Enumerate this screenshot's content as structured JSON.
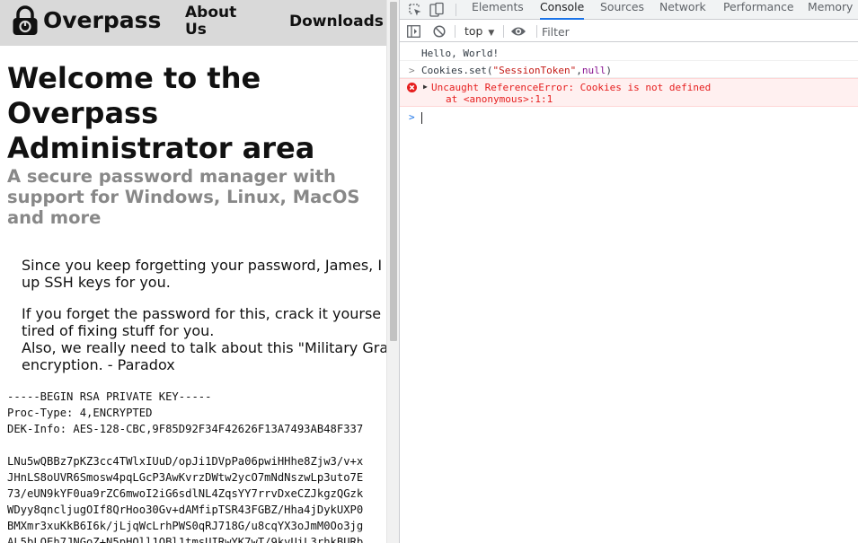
{
  "site": {
    "name": "Overpass",
    "nav": {
      "about": "About Us",
      "downloads": "Downloads"
    }
  },
  "content": {
    "title": "Welcome to the Overpass Administrator area",
    "subtitle": "A secure password manager with support for Windows, Linux, MacOS and more",
    "message1": "Since you keep forgetting your password, James, I\nup SSH keys for you.",
    "message2": "If you forget the password for this, crack it yourse\ntired of fixing stuff for you.\nAlso, we really need to talk about this \"Military Gra\nencryption. - Paradox",
    "key_text": "-----BEGIN RSA PRIVATE KEY-----\nProc-Type: 4,ENCRYPTED\nDEK-Info: AES-128-CBC,9F85D92F34F42626F13A7493AB48F337\n\nLNu5wQBBz7pKZ3cc4TWlxIUuD/opJi1DVpPa06pwiHHhe8Zjw3/v+x\nJHnLS8oUVR6Smosw4pqLGcP3AwKvrzDWtw2ycO7mNdNszwLp3uto7E\n73/eUN9kYF0ua9rZC6mwoI2iG6sdlNL4ZqsYY7rrvDxeCZJkgzQGzk\nWDyy8qncljugOIf8QrHoo30Gv+dAMfipTSR43FGBZ/Hha4jDykUXP0\nBMXmr3xuKkB6I6k/jLjqWcLrhPWS0qRJ718G/u8cqYX3oJmM0Oo3jg\nAL5bLOEh7JNGoZ+N5pHOll1OBl1tmsUIRwYK7wT/9kvUiL3rhkBURb"
  },
  "devtools": {
    "tabs": [
      "Elements",
      "Console",
      "Sources",
      "Network",
      "Performance",
      "Memory"
    ],
    "active_tab": "Console",
    "context": "top",
    "filter_placeholder": "Filter",
    "console": {
      "log": "Hello, World!",
      "input_prefix": "Cookies.set(",
      "input_arg1": "\"SessionToken\"",
      "input_comma": ",",
      "input_arg2": "null",
      "input_suffix": ")",
      "error_message": "Uncaught ReferenceError: Cookies is not defined",
      "error_location": "at <anonymous>:1:1"
    }
  }
}
